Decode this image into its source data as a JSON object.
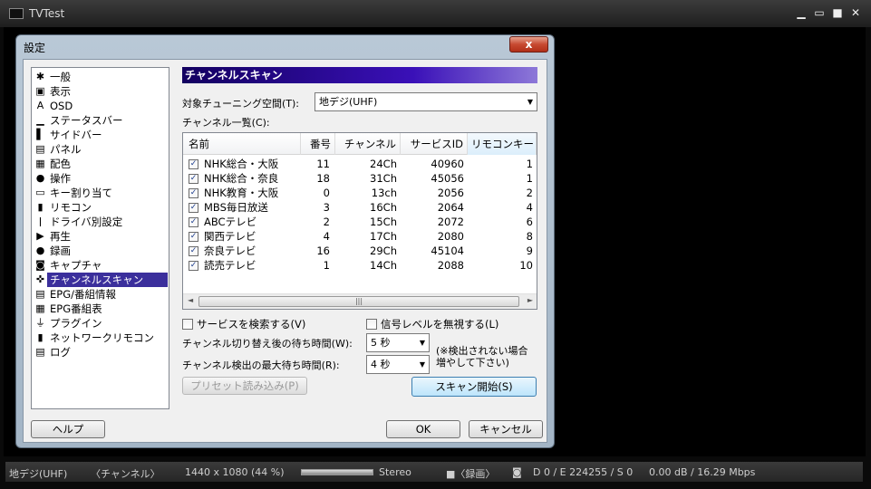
{
  "app": {
    "title": "TVTest",
    "controls": [
      "minimize-icon",
      "restore-icon",
      "fullscreen-icon",
      "close-icon"
    ]
  },
  "statusbar": {
    "channel": "地デジ(UHF)",
    "channel_name": "〈チャンネル〉",
    "resolution": "1440 x 1080 (44 %)",
    "audio": "Stereo",
    "record": "■〈録画〉",
    "error": "D 0 / E 224255 / S 0",
    "signal": "0.00 dB / 16.29 Mbps"
  },
  "dialog": {
    "title": "設定",
    "close_label": "x",
    "tree": [
      {
        "label": "一般",
        "icon": "gear-icon",
        "glyph": "✱"
      },
      {
        "label": "表示",
        "icon": "display-icon",
        "glyph": "▣"
      },
      {
        "label": "OSD",
        "icon": "osd-icon",
        "glyph": "A"
      },
      {
        "label": "ステータスバー",
        "icon": "statusbar-icon",
        "glyph": "▁"
      },
      {
        "label": "サイドバー",
        "icon": "sidebar-icon",
        "glyph": "▌"
      },
      {
        "label": "パネル",
        "icon": "panel-icon",
        "glyph": "▤"
      },
      {
        "label": "配色",
        "icon": "palette-icon",
        "glyph": "▦"
      },
      {
        "label": "操作",
        "icon": "mouse-icon",
        "glyph": "●"
      },
      {
        "label": "キー割り当て",
        "icon": "keyboard-icon",
        "glyph": "▭"
      },
      {
        "label": "リモコン",
        "icon": "remote-icon",
        "glyph": "▮"
      },
      {
        "label": "ドライバ別設定",
        "icon": "driver-icon",
        "glyph": "ǀ"
      },
      {
        "label": "再生",
        "icon": "play-icon",
        "glyph": "▶"
      },
      {
        "label": "録画",
        "icon": "record-icon",
        "glyph": "●"
      },
      {
        "label": "キャプチャ",
        "icon": "camera-icon",
        "glyph": "◙"
      },
      {
        "label": "チャンネルスキャン",
        "icon": "channel-scan-icon",
        "glyph": "✜",
        "selected": true
      },
      {
        "label": "EPG/番組情報",
        "icon": "epg-icon",
        "glyph": "▤"
      },
      {
        "label": "EPG番組表",
        "icon": "program-guide-icon",
        "glyph": "▦"
      },
      {
        "label": "プラグイン",
        "icon": "plugin-icon",
        "glyph": "⏚"
      },
      {
        "label": "ネットワークリモコン",
        "icon": "network-remote-icon",
        "glyph": "▮"
      },
      {
        "label": "ログ",
        "icon": "log-icon",
        "glyph": "▤"
      }
    ],
    "panel": {
      "heading": "チャンネルスキャン",
      "tuning_space_label": "対象チューニング空間(T):",
      "tuning_space_value": "地デジ(UHF)",
      "channel_list_label": "チャンネル一覧(C):",
      "columns": [
        "名前",
        "番号",
        "チャンネル",
        "サービスID",
        "リモコンキー"
      ],
      "rows": [
        {
          "name": "NHK総合・大阪",
          "number": "11",
          "channel": "24Ch",
          "service_id": "40960",
          "key": "1"
        },
        {
          "name": "NHK総合・奈良",
          "number": "18",
          "channel": "31Ch",
          "service_id": "45056",
          "key": "1"
        },
        {
          "name": "NHK教育・大阪",
          "number": "0",
          "channel": "13ch",
          "service_id": "2056",
          "key": "2"
        },
        {
          "name": "MBS毎日放送",
          "number": "3",
          "channel": "16Ch",
          "service_id": "2064",
          "key": "4"
        },
        {
          "name": "ABCテレビ",
          "number": "2",
          "channel": "15Ch",
          "service_id": "2072",
          "key": "6"
        },
        {
          "name": "関西テレビ",
          "number": "4",
          "channel": "17Ch",
          "service_id": "2080",
          "key": "8"
        },
        {
          "name": "奈良テレビ",
          "number": "16",
          "channel": "29Ch",
          "service_id": "45104",
          "key": "9"
        },
        {
          "name": "読売テレビ",
          "number": "1",
          "channel": "14Ch",
          "service_id": "2088",
          "key": "10"
        }
      ],
      "search_service_label": "サービスを検索する(V)",
      "ignore_signal_label": "信号レベルを無視する(L)",
      "switch_wait_label": "チャンネル切り替え後の待ち時間(W):",
      "switch_wait_value": "5 秒",
      "detect_wait_label": "チャンネル検出の最大待ち時間(R):",
      "detect_wait_value": "4 秒",
      "note_line1": "(※検出されない場合",
      "note_line2": "増やして下さい)",
      "preset_button": "プリセット読み込み(P)",
      "scan_button": "スキャン開始(S)"
    },
    "help_button": "ヘルプ",
    "ok_button": "OK",
    "cancel_button": "キャンセル"
  }
}
